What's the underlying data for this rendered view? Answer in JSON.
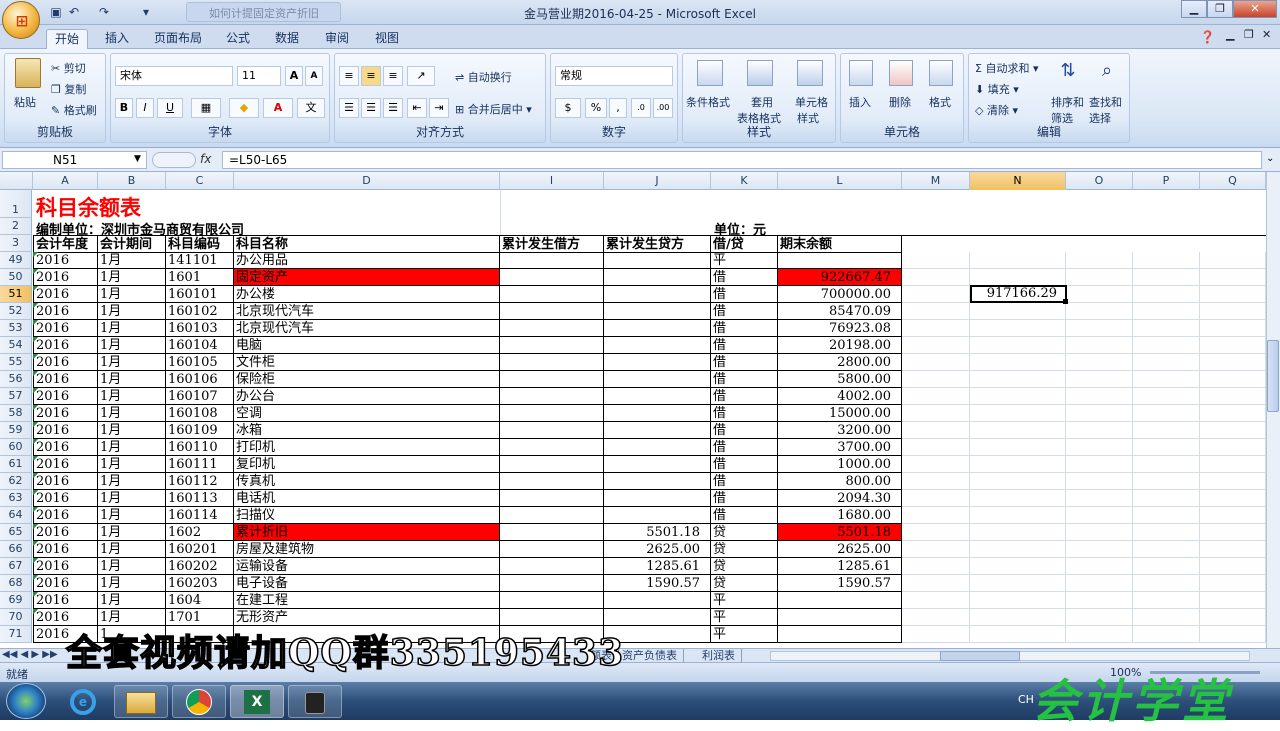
{
  "window": {
    "title": "金马营业期2016-04-25 - Microsoft Excel",
    "doc_tab": "如何计提固定资产折旧"
  },
  "menu": {
    "tabs": [
      "开始",
      "插入",
      "页面布局",
      "公式",
      "数据",
      "审阅",
      "视图"
    ]
  },
  "ribbon": {
    "clipboard": {
      "label": "剪贴板",
      "paste": "粘贴",
      "cut": "剪切",
      "copy": "复制",
      "format_painter": "格式刷"
    },
    "font": {
      "label": "字体",
      "name": "宋体",
      "size": "11",
      "bold": "B",
      "italic": "I",
      "underline": "U"
    },
    "alignment": {
      "label": "对齐方式",
      "wrap": "自动换行",
      "merge": "合并后居中"
    },
    "number": {
      "label": "数字",
      "format": "常规",
      "percent": "%",
      "comma": ","
    },
    "styles": {
      "label": "样式",
      "conditional": "条件格式",
      "table_line1": "套用",
      "table_line2": "表格格式",
      "cell_line1": "单元格",
      "cell_line2": "样式"
    },
    "cells": {
      "label": "单元格",
      "insert": "插入",
      "delete": "删除",
      "format": "格式"
    },
    "editing": {
      "label": "编辑",
      "autosum": "自动求和",
      "fill": "填充",
      "clear": "清除",
      "sort_line1": "排序和",
      "sort_line2": "筛选",
      "find_line1": "查找和",
      "find_line2": "选择"
    }
  },
  "formula_bar": {
    "name_box": "N51",
    "fx": "fx",
    "formula": "=L50-L65"
  },
  "columns": [
    "A",
    "B",
    "C",
    "D",
    "I",
    "J",
    "K",
    "L",
    "M",
    "N",
    "O",
    "P",
    "Q"
  ],
  "sheet": {
    "title": "科目余额表",
    "company": "编制单位：深圳市金马商贸有限公司",
    "unit": "单位：元",
    "headers": [
      "会计年度",
      "会计期间",
      "科目编码",
      "科目名称",
      "累计发生借方",
      "累计发生贷方",
      "借/贷",
      "期末余额"
    ],
    "header_row_nums": [
      "1",
      "2",
      "3"
    ],
    "rows": [
      {
        "r": "49",
        "a": "2016",
        "b": "1月",
        "c": "141101",
        "d": "办公用品",
        "i": "",
        "j": "",
        "k": "平",
        "l": ""
      },
      {
        "r": "50",
        "a": "2016",
        "b": "1月",
        "c": "1601",
        "d": "固定资产",
        "i": "",
        "j": "",
        "k": "借",
        "l": "922667.47"
      },
      {
        "r": "51",
        "a": "2016",
        "b": "1月",
        "c": "160101",
        "d": "办公楼",
        "i": "",
        "j": "",
        "k": "借",
        "l": "700000.00"
      },
      {
        "r": "52",
        "a": "2016",
        "b": "1月",
        "c": "160102",
        "d": "北京现代汽车",
        "i": "",
        "j": "",
        "k": "借",
        "l": "85470.09"
      },
      {
        "r": "53",
        "a": "2016",
        "b": "1月",
        "c": "160103",
        "d": "北京现代汽车",
        "i": "",
        "j": "",
        "k": "借",
        "l": "76923.08"
      },
      {
        "r": "54",
        "a": "2016",
        "b": "1月",
        "c": "160104",
        "d": "电脑",
        "i": "",
        "j": "",
        "k": "借",
        "l": "20198.00"
      },
      {
        "r": "55",
        "a": "2016",
        "b": "1月",
        "c": "160105",
        "d": "文件柜",
        "i": "",
        "j": "",
        "k": "借",
        "l": "2800.00"
      },
      {
        "r": "56",
        "a": "2016",
        "b": "1月",
        "c": "160106",
        "d": "保险柜",
        "i": "",
        "j": "",
        "k": "借",
        "l": "5800.00"
      },
      {
        "r": "57",
        "a": "2016",
        "b": "1月",
        "c": "160107",
        "d": "办公台",
        "i": "",
        "j": "",
        "k": "借",
        "l": "4002.00"
      },
      {
        "r": "58",
        "a": "2016",
        "b": "1月",
        "c": "160108",
        "d": "空调",
        "i": "",
        "j": "",
        "k": "借",
        "l": "15000.00"
      },
      {
        "r": "59",
        "a": "2016",
        "b": "1月",
        "c": "160109",
        "d": "冰箱",
        "i": "",
        "j": "",
        "k": "借",
        "l": "3200.00"
      },
      {
        "r": "60",
        "a": "2016",
        "b": "1月",
        "c": "160110",
        "d": "打印机",
        "i": "",
        "j": "",
        "k": "借",
        "l": "3700.00"
      },
      {
        "r": "61",
        "a": "2016",
        "b": "1月",
        "c": "160111",
        "d": "复印机",
        "i": "",
        "j": "",
        "k": "借",
        "l": "1000.00"
      },
      {
        "r": "62",
        "a": "2016",
        "b": "1月",
        "c": "160112",
        "d": "传真机",
        "i": "",
        "j": "",
        "k": "借",
        "l": "800.00"
      },
      {
        "r": "63",
        "a": "2016",
        "b": "1月",
        "c": "160113",
        "d": "电话机",
        "i": "",
        "j": "",
        "k": "借",
        "l": "2094.30"
      },
      {
        "r": "64",
        "a": "2016",
        "b": "1月",
        "c": "160114",
        "d": "扫描仪",
        "i": "",
        "j": "",
        "k": "借",
        "l": "1680.00"
      },
      {
        "r": "65",
        "a": "2016",
        "b": "1月",
        "c": "1602",
        "d": "累计折旧",
        "i": "",
        "j": "5501.18",
        "k": "贷",
        "l": "5501.18"
      },
      {
        "r": "66",
        "a": "2016",
        "b": "1月",
        "c": "160201",
        "d": "房屋及建筑物",
        "i": "",
        "j": "2625.00",
        "k": "贷",
        "l": "2625.00"
      },
      {
        "r": "67",
        "a": "2016",
        "b": "1月",
        "c": "160202",
        "d": "运输设备",
        "i": "",
        "j": "1285.61",
        "k": "贷",
        "l": "1285.61"
      },
      {
        "r": "68",
        "a": "2016",
        "b": "1月",
        "c": "160203",
        "d": "电子设备",
        "i": "",
        "j": "1590.57",
        "k": "贷",
        "l": "1590.57"
      },
      {
        "r": "69",
        "a": "2016",
        "b": "1月",
        "c": "1604",
        "d": "在建工程",
        "i": "",
        "j": "",
        "k": "平",
        "l": ""
      },
      {
        "r": "70",
        "a": "2016",
        "b": "1月",
        "c": "1701",
        "d": "无形资产",
        "i": "",
        "j": "",
        "k": "平",
        "l": ""
      },
      {
        "r": "71",
        "a": "2016",
        "b": "1",
        "c": "",
        "d": "",
        "i": "",
        "j": "",
        "k": "平",
        "l": ""
      }
    ],
    "highlight_rows": [
      "50",
      "65"
    ],
    "n51_value": "917166.29"
  },
  "sheet_tabs": [
    "额表",
    "资产负债表",
    "利润表"
  ],
  "status": {
    "ready": "就绪",
    "zoom": "100%"
  },
  "taskbar": {
    "lang": "CH"
  },
  "overlay_text": "全套视频请加QQ群335195433",
  "watermark_text": "会计学堂",
  "colors": {
    "highlight": "#ff0000",
    "title_red": "#ff0000",
    "selection_orange": "#f1c15f"
  }
}
